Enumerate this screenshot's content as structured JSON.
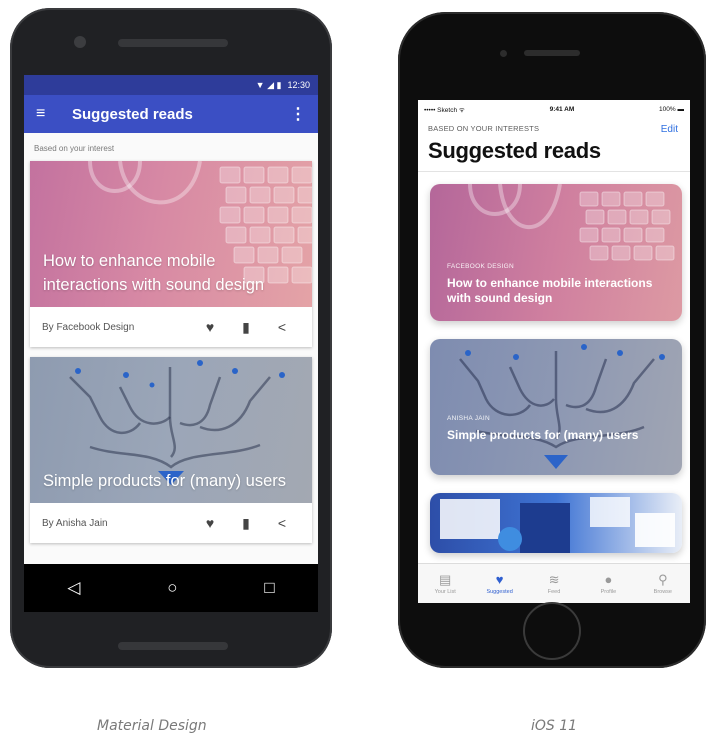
{
  "android": {
    "status_time": "12:30",
    "status_icons": "▼ ◢ ▮",
    "appbar_title": "Suggested reads",
    "section_label": "Based on your interest",
    "cards": [
      {
        "title": "How to enhance mobile interactions with sound design",
        "author": "By Facebook Design"
      },
      {
        "title": "Simple products for (many) users",
        "author": "By Anisha Jain"
      }
    ],
    "icons": {
      "menu": "≡",
      "more": "⋮",
      "heart": "♥",
      "bookmark": "▮",
      "share": "<",
      "nav_back": "◁",
      "nav_home": "○",
      "nav_recents": "□"
    },
    "colors": {
      "status_bar": "#2e3c9a",
      "app_bar": "#3b4fc4"
    }
  },
  "ios": {
    "status_carrier": "••••• Sketch ᯤ",
    "status_time": "9:41 AM",
    "status_battery": "100% ▬",
    "kicker": "BASED ON YOUR INTERESTS",
    "edit_label": "Edit",
    "title": "Suggested reads",
    "cards": [
      {
        "kicker": "FACEBOOK DESIGN",
        "title": "How to enhance mobile interactions with sound design"
      },
      {
        "kicker": "ANISHA JAIN",
        "title": "Simple products for (many) users"
      }
    ],
    "tabs": [
      {
        "label": "Your List",
        "icon": "▤"
      },
      {
        "label": "Suggested",
        "icon": "♥"
      },
      {
        "label": "Feed",
        "icon": "≋"
      },
      {
        "label": "Profile",
        "icon": "●"
      },
      {
        "label": "Browse",
        "icon": "⚲"
      }
    ],
    "colors": {
      "accent": "#2f5fd0",
      "edit": "#2f6fe0"
    }
  },
  "captions": {
    "left": "Material Design",
    "right": "iOS 11"
  }
}
